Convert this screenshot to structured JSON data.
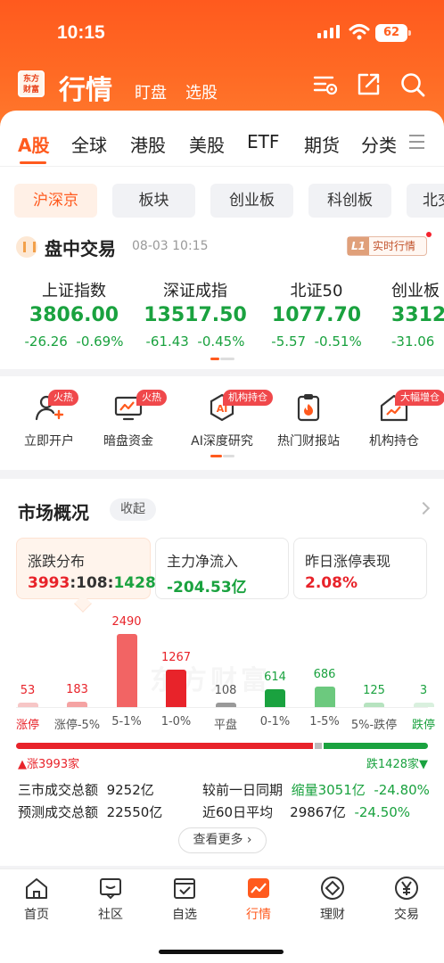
{
  "status": {
    "time": "10:15",
    "battery": "62"
  },
  "header": {
    "logo_text": "东方财富",
    "title": "行情",
    "sub_tabs": [
      "盯盘",
      "选股"
    ]
  },
  "market_tabs": [
    "A股",
    "全球",
    "港股",
    "美股",
    "ETF",
    "期货",
    "分类"
  ],
  "region_pills": [
    "沪深京",
    "板块",
    "创业板",
    "科创板",
    "北交"
  ],
  "session": {
    "title": "盘中交易",
    "time": "08-03 10:15",
    "badge_l1": "L1",
    "badge_label": "实时行情"
  },
  "indices": [
    {
      "name": "上证指数",
      "value": "3806.00",
      "change": "-26.26",
      "pct": "-0.69%"
    },
    {
      "name": "深证成指",
      "value": "13517.50",
      "change": "-61.43",
      "pct": "-0.45%"
    },
    {
      "name": "北证50",
      "value": "1077.70",
      "change": "-5.57",
      "pct": "-0.51%"
    },
    {
      "name": "创业板",
      "value": "3312",
      "change": "-31.06",
      "pct": ""
    }
  ],
  "quick_links": [
    {
      "label": "立即开户",
      "badge": "火热",
      "icon": "user-plus-icon"
    },
    {
      "label": "暗盘资金",
      "badge": "火热",
      "icon": "monitor-chart-icon"
    },
    {
      "label": "AI深度研究",
      "badge": "机构持仓",
      "icon": "ai-icon"
    },
    {
      "label": "热门财报站",
      "badge": "",
      "icon": "clipboard-fire-icon"
    },
    {
      "label": "机构持仓",
      "badge": "大幅增仓",
      "icon": "house-chart-icon"
    }
  ],
  "overview": {
    "title": "市场概况",
    "collapse": "收起",
    "cards": [
      {
        "title": "涨跌分布",
        "up": "3993",
        "sep1": ":",
        "flat": "108",
        "sep2": ":",
        "down": "1428"
      },
      {
        "title": "主力净流入",
        "value": "-204.53亿"
      },
      {
        "title": "昨日涨停表现",
        "value": "2.08%"
      }
    ],
    "watermark": "东方财富",
    "up_label": "涨3993家",
    "down_label": "跌1428家",
    "stats": {
      "turnover_label": "三市成交总额",
      "turnover_value": "9252亿",
      "compare_label": "较前一日同期",
      "compare_tag": "缩量",
      "compare_value": "3051亿",
      "compare_pct": "-24.80%",
      "forecast_label": "预测成交总额",
      "forecast_value": "22550亿",
      "avg_label": "近60日平均",
      "avg_value": "29867亿",
      "avg_pct": "-24.50%"
    },
    "more": "查看更多"
  },
  "chart_data": {
    "type": "bar",
    "categories": [
      "涨停",
      "涨停-5%",
      "5-1%",
      "1-0%",
      "平盘",
      "0-1%",
      "1-5%",
      "5%-跌停",
      "跌停"
    ],
    "values": [
      53,
      183,
      2490,
      1267,
      108,
      614,
      686,
      125,
      3
    ],
    "bar_colors": [
      "#f7c6c6",
      "#f5a3a3",
      "#f26464",
      "#e8232a",
      "#999999",
      "#1aa23f",
      "#6cc97e",
      "#b6e3bf",
      "#d9f0de"
    ],
    "label_colors": [
      "#e8232a",
      "#555555",
      "#555555",
      "#555555",
      "#555555",
      "#555555",
      "#555555",
      "#555555",
      "#1aa23f"
    ],
    "split": {
      "up": 3993,
      "flat": 108,
      "down": 1428
    }
  },
  "tabbar": [
    {
      "label": "首页",
      "icon": "home-icon"
    },
    {
      "label": "社区",
      "icon": "chat-icon"
    },
    {
      "label": "自选",
      "icon": "check-box-icon"
    },
    {
      "label": "行情",
      "icon": "trend-chart-icon"
    },
    {
      "label": "理财",
      "icon": "diamond-icon"
    },
    {
      "label": "交易",
      "icon": "yen-icon"
    }
  ],
  "colors": {
    "brand": "#ff5a1e",
    "up": "#e8232a",
    "down": "#1aa23f"
  }
}
